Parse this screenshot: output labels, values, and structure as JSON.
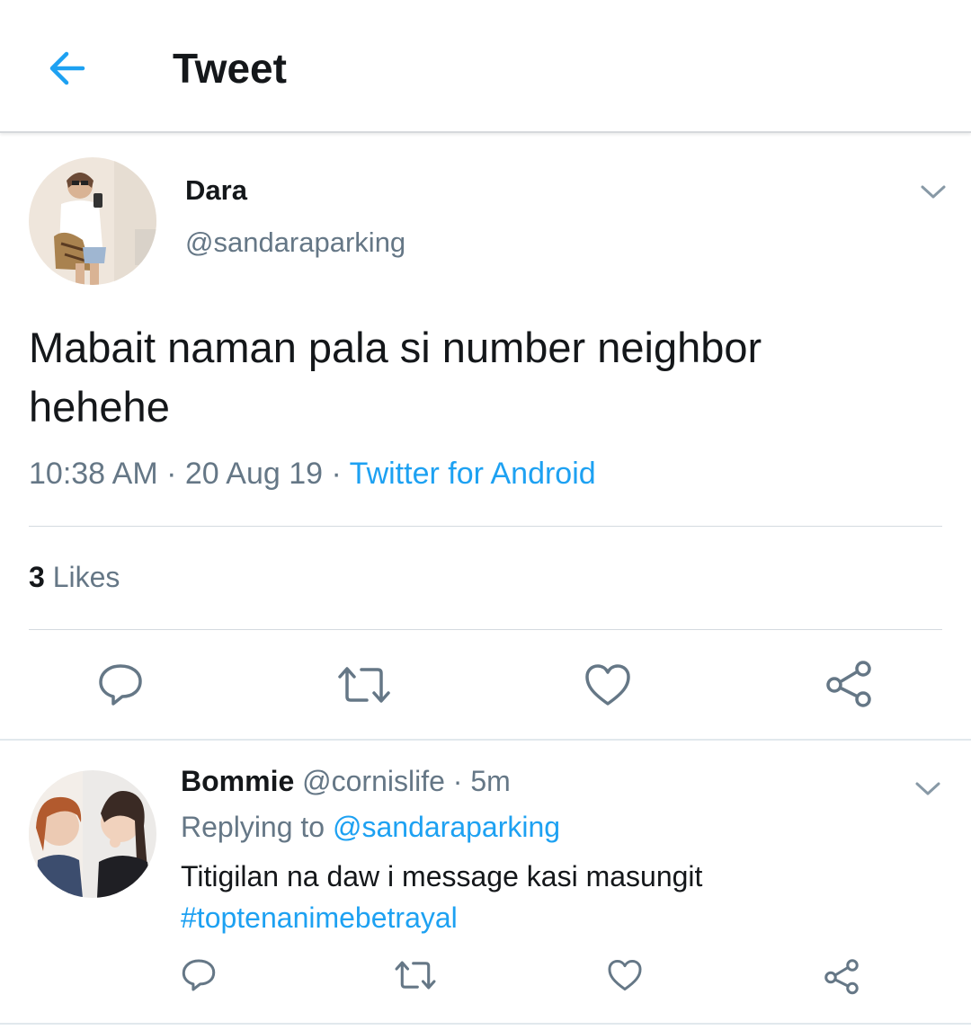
{
  "header": {
    "title": "Tweet",
    "back_icon": "arrow-left-icon",
    "accent": "#1da1f2"
  },
  "tweet": {
    "name": "Dara",
    "handle": "@sandaraparking",
    "text_line1": "Mabait naman pala si number neighbor",
    "text_line2": "hehehe",
    "time": "10:38 AM",
    "date": "20 Aug 19",
    "sep": "·",
    "source": "Twitter for Android",
    "likes_count": "3",
    "likes_label": "Likes",
    "actions": [
      "reply-icon",
      "retweet-icon",
      "like-icon",
      "share-icon"
    ]
  },
  "reply": {
    "name": "Bommie",
    "handle": "@cornislife",
    "sep": "·",
    "time": "5m",
    "replying_prefix": "Replying to",
    "replying_to": "@sandaraparking",
    "text": "Titigilan na daw i message kasi masungit",
    "hashtag": "#toptenanimebetrayal",
    "actions": [
      "reply-icon",
      "retweet-icon",
      "like-icon",
      "share-icon"
    ]
  },
  "colors": {
    "text": "#14171a",
    "secondary": "#657786",
    "link": "#1da1f2",
    "divider": "#e1e8ed"
  }
}
